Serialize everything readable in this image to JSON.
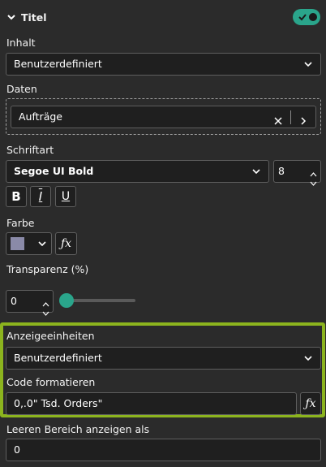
{
  "section": {
    "title": "Titel",
    "toggle_on": true
  },
  "inhalt": {
    "label": "Inhalt",
    "value": "Benutzerdefiniert"
  },
  "daten": {
    "label": "Daten",
    "value": "Aufträge"
  },
  "schriftart": {
    "label": "Schriftart",
    "font": "Segoe UI Bold",
    "size": "8"
  },
  "format_buttons": {
    "bold": "B",
    "italic": "I",
    "underline": "U"
  },
  "farbe": {
    "label": "Farbe",
    "swatch_color": "#8a8aa8"
  },
  "transparenz": {
    "label": "Transparenz (%)",
    "value": "0",
    "slider_value": 0
  },
  "anzeigeeinheiten": {
    "label": "Anzeigeeinheiten",
    "value": "Benutzerdefiniert"
  },
  "code": {
    "label": "Code formatieren",
    "value": "0,.0\" Tsd. Orders\""
  },
  "leeren": {
    "label": "Leeren Bereich anzeigen als",
    "value": "0"
  },
  "colors": {
    "background": "#2b2b2b",
    "accent": "#2aa58b",
    "highlight": "#8cb41e"
  }
}
